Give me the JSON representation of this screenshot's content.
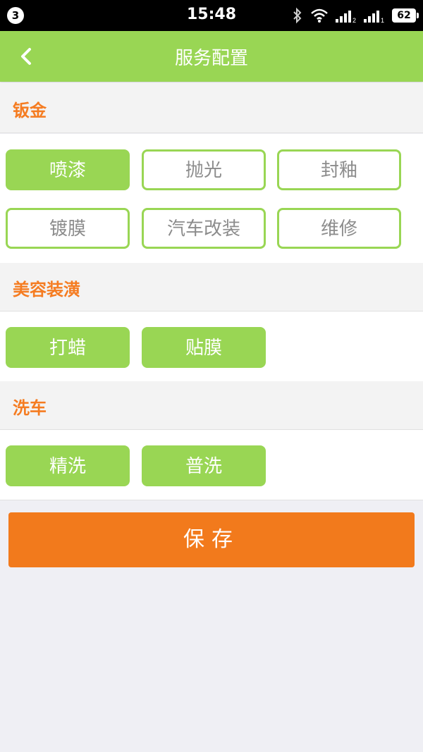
{
  "status_bar": {
    "notification_count": "3",
    "time": "15:48",
    "battery": "62",
    "icons": [
      "bluetooth-icon",
      "wifi-icon",
      "signal-icon",
      "signal-icon"
    ]
  },
  "header": {
    "title": "服务配置",
    "back_icon": "chevron-left-icon"
  },
  "sections": [
    {
      "title": "钣金",
      "items": [
        {
          "label": "喷漆",
          "selected": true
        },
        {
          "label": "抛光",
          "selected": false
        },
        {
          "label": "封釉",
          "selected": false
        },
        {
          "label": "镀膜",
          "selected": false
        },
        {
          "label": "汽车改装",
          "selected": false
        },
        {
          "label": "维修",
          "selected": false
        }
      ]
    },
    {
      "title": "美容装潢",
      "items": [
        {
          "label": "打蜡",
          "selected": true
        },
        {
          "label": "贴膜",
          "selected": true
        }
      ]
    },
    {
      "title": "洗车",
      "items": [
        {
          "label": "精洗",
          "selected": true
        },
        {
          "label": "普洗",
          "selected": true
        }
      ]
    }
  ],
  "save_label": "保存",
  "colors": {
    "accent_green": "#99d654",
    "accent_orange": "#f27a1c",
    "section_title": "#f57c21"
  }
}
